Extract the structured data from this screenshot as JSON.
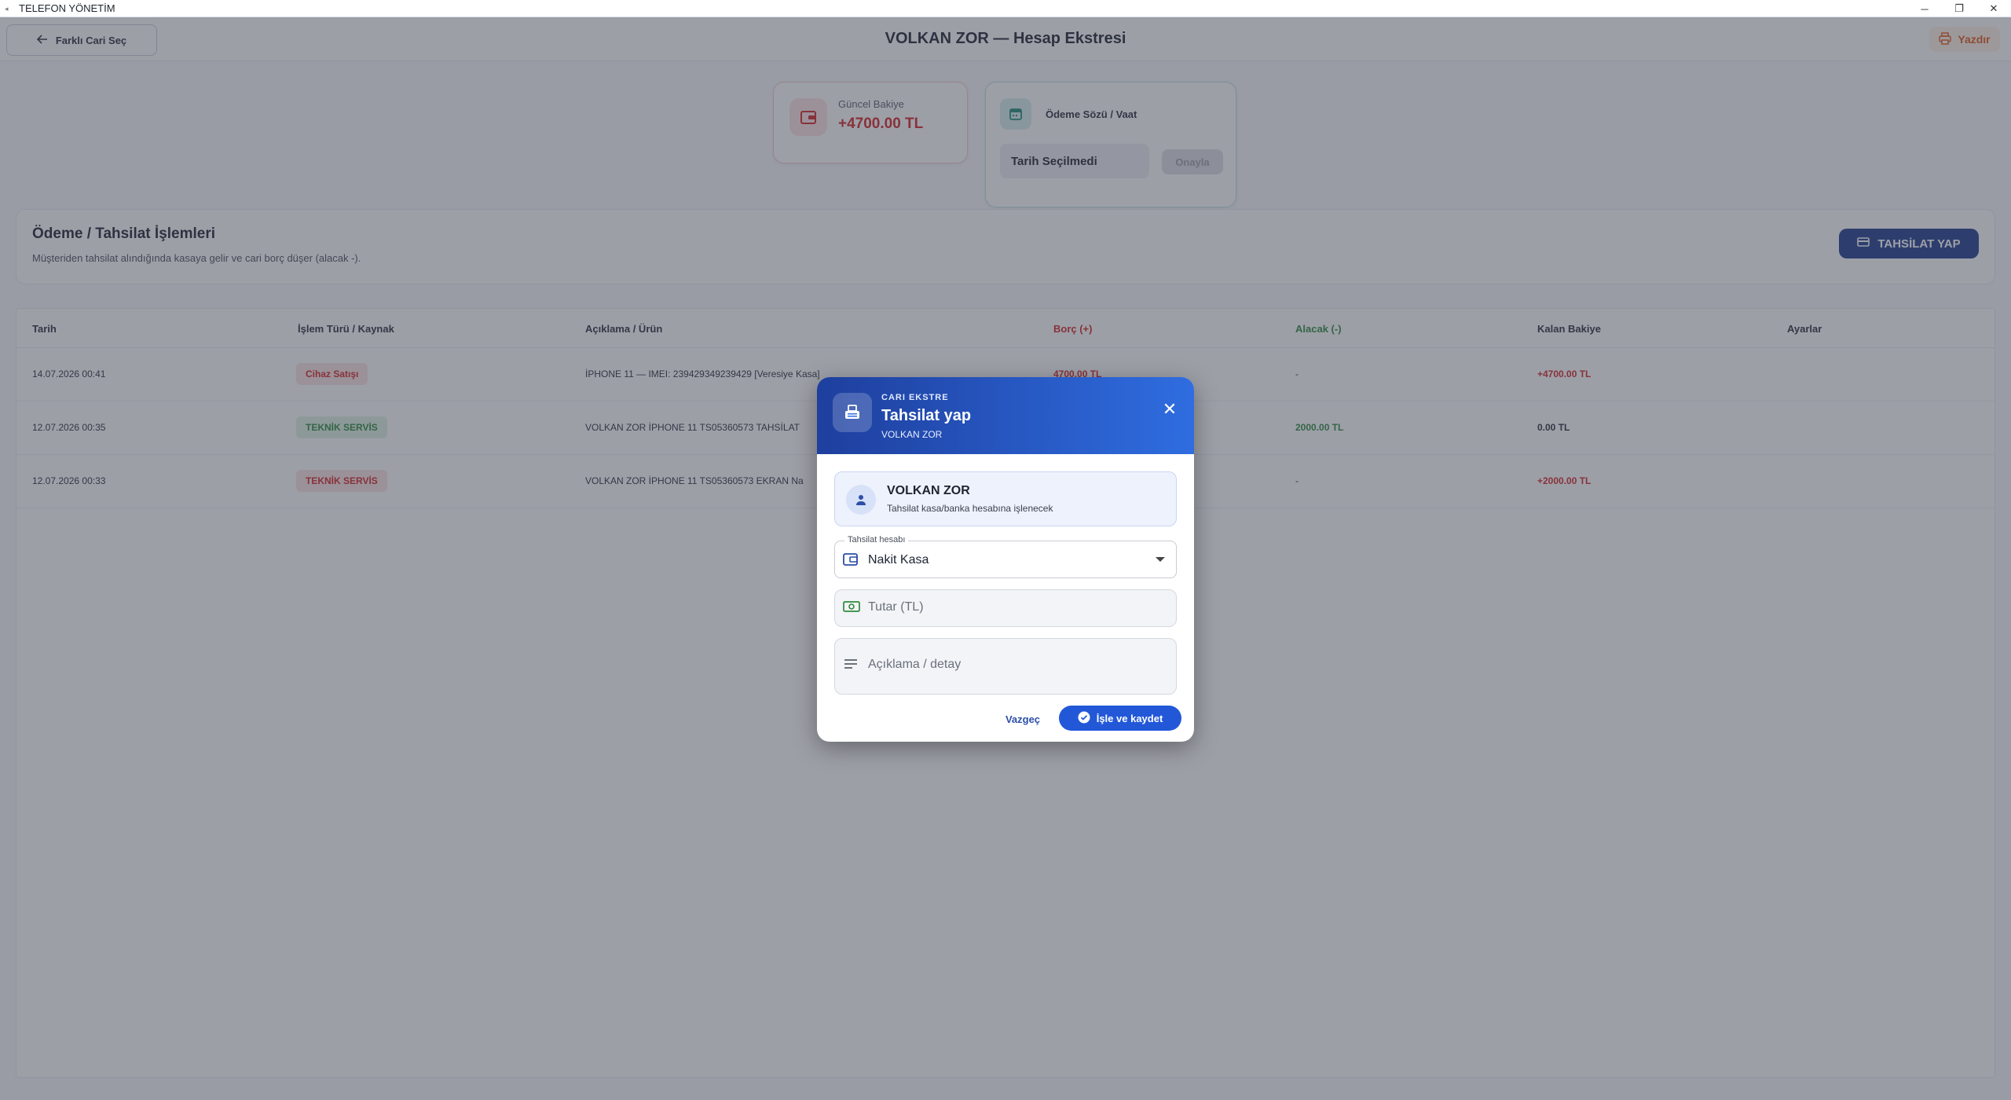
{
  "window": {
    "title": "TELEFON YÖNETİM",
    "controls": [
      "─",
      "❐",
      "✕"
    ]
  },
  "header": {
    "back_label": "Farklı Cari Seç",
    "title": "VOLKAN ZOR — Hesap Ekstresi",
    "print_label": "Yazdır"
  },
  "balance": {
    "label": "Güncel Bakiye",
    "value": "+4700.00 TL"
  },
  "promise": {
    "label": "Ödeme Sözü / Vaat",
    "date_text": "Tarih Seçilmedi",
    "confirm_label": "Onayla"
  },
  "operations": {
    "title": "Ödeme / Tahsilat İşlemleri",
    "description": "Müşteriden tahsilat alındığında kasaya gelir ve cari borç düşer (alacak -).",
    "collect_label": "TAHSİLAT YAP"
  },
  "table": {
    "columns": [
      "Tarih",
      "İşlem Türü / Kaynak",
      "Açıklama / Ürün",
      "Borç (+)",
      "Alacak (-)",
      "Kalan Bakiye",
      "Ayarlar"
    ],
    "rows": [
      {
        "date": "14.07.2026 00:41",
        "type": "Cihaz Satışı",
        "type_color": "red",
        "desc": "İPHONE 11 — IMEI: 239429349239429 [Veresiye Kasa]",
        "debit": "4700.00 TL",
        "credit": "-",
        "balance": "+4700.00 TL",
        "balance_color": "red"
      },
      {
        "date": "12.07.2026 00:35",
        "type": "TEKNİK SERVİS",
        "type_color": "green",
        "desc": "VOLKAN ZOR İPHONE 11 TS05360573 TAHSİLAT",
        "debit": "",
        "credit": "2000.00 TL",
        "balance": "0.00 TL",
        "balance_color": "black"
      },
      {
        "date": "12.07.2026 00:33",
        "type": "TEKNİK SERVİS",
        "type_color": "red",
        "desc": "VOLKAN ZOR İPHONE 11 TS05360573 EKRAN Na",
        "debit": "",
        "credit": "-",
        "balance": "+2000.00 TL",
        "balance_color": "red"
      }
    ]
  },
  "dialog": {
    "overline": "CARI EKSTRE",
    "title": "Tahsilat yap",
    "subtitle": "VOLKAN ZOR",
    "customer_name": "VOLKAN ZOR",
    "customer_note": "Tahsilat kasa/banka hesabına işlenecek",
    "account_label": "Tahsilat hesabı",
    "account_value": "Nakit Kasa",
    "amount_placeholder": "Tutar (TL)",
    "desc_placeholder": "Açıklama / detay",
    "cancel_label": "Vazgeç",
    "save_label": "İşle ve kaydet"
  },
  "colors": {
    "primary": "#2258d8",
    "header_start": "#1e3f9e",
    "danger": "#d42424",
    "success": "#2d8a3e",
    "accent_orange": "#e05a1a"
  }
}
